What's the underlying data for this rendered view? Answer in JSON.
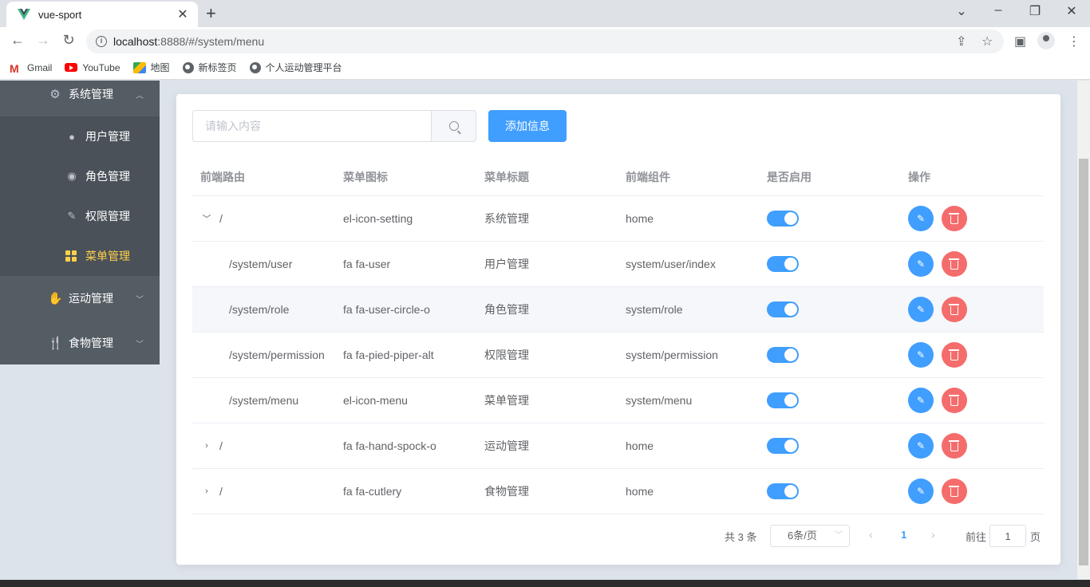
{
  "browser": {
    "tab_title": "vue-sport",
    "url_host": "localhost",
    "url_rest": ":8888/#/system/menu",
    "bookmarks": [
      "Gmail",
      "YouTube",
      "地图",
      "新标签页",
      "个人运动管理平台"
    ]
  },
  "sidebar": {
    "system": "系统管理",
    "sub": [
      "用户管理",
      "角色管理",
      "权限管理",
      "菜单管理"
    ],
    "sport": "运动管理",
    "food": "食物管理"
  },
  "toolbar": {
    "search_placeholder": "请输入内容",
    "add_label": "添加信息"
  },
  "table": {
    "headers": [
      "前端路由",
      "菜单图标",
      "菜单标题",
      "前端组件",
      "是否启用",
      "操作"
    ],
    "rows": [
      {
        "route": "/",
        "icon": "el-icon-setting",
        "title": "系统管理",
        "component": "home",
        "enabled": true
      },
      {
        "route": "/system/user",
        "icon": "fa fa-user",
        "title": "用户管理",
        "component": "system/user/index",
        "enabled": true
      },
      {
        "route": "/system/role",
        "icon": "fa fa-user-circle-o",
        "title": "角色管理",
        "component": "system/role",
        "enabled": true
      },
      {
        "route": "/system/permission",
        "icon": "fa fa-pied-piper-alt",
        "title": "权限管理",
        "component": "system/permission",
        "enabled": true
      },
      {
        "route": "/system/menu",
        "icon": "el-icon-menu",
        "title": "菜单管理",
        "component": "system/menu",
        "enabled": true
      },
      {
        "route": "/",
        "icon": "fa fa-hand-spock-o",
        "title": "运动管理",
        "component": "home",
        "enabled": true
      },
      {
        "route": "/",
        "icon": "fa fa-cutlery",
        "title": "食物管理",
        "component": "home",
        "enabled": true
      }
    ]
  },
  "pagination": {
    "total": "共 3 条",
    "page_size": "6条/页",
    "current": "1",
    "goto_prefix": "前往",
    "goto_value": "1",
    "goto_suffix": "页"
  },
  "colors": {
    "primary": "#409eff",
    "danger": "#f56c6c",
    "sidebar": "#545c64",
    "active": "#ffd04b"
  }
}
